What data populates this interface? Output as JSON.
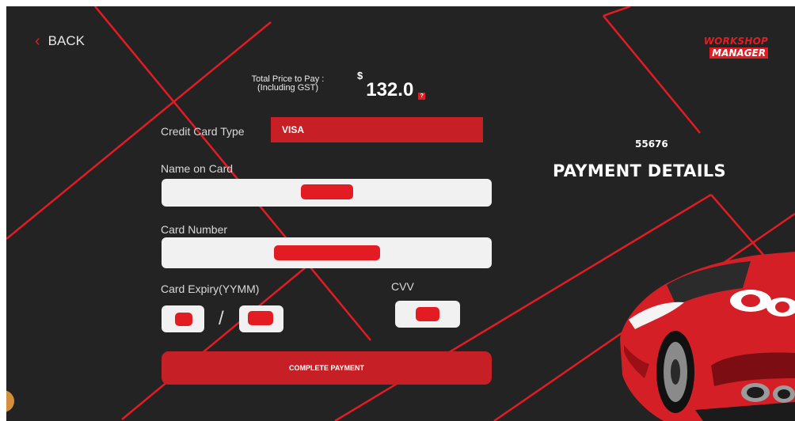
{
  "nav": {
    "back_label": "BACK",
    "back_icon": "chevron-left-icon"
  },
  "brand": {
    "line1": "WORKSHOP",
    "line2": "MANAGER"
  },
  "price": {
    "label_line1": "Total Price to Pay :",
    "label_line2": "(Including GST)",
    "currency": "$",
    "amount": "132.0"
  },
  "order_number": "55676",
  "page_title": "PAYMENT DETAILS",
  "form": {
    "card_type_label": "Credit Card Type",
    "card_type_value": "VISA",
    "name_label": "Name on Card",
    "card_number_label": "Card Number",
    "expiry_label": "Card Expiry(YYMM)",
    "expiry_separator": "/",
    "cvv_label": "CVV"
  },
  "submit_label": "COMPLETE PAYMENT",
  "colors": {
    "accent": "#e31c24",
    "background": "#232323",
    "button": "#c62026",
    "field": "#f1f1f1"
  }
}
